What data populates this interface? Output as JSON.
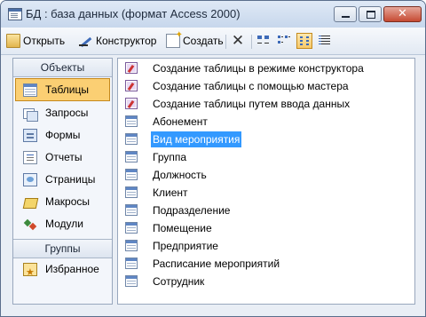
{
  "window": {
    "title": "БД : база данных (формат Access 2000)",
    "close_glyph": "✕"
  },
  "toolbar": {
    "open_label": "Открыть",
    "design_label": "Конструктор",
    "new_label": "Создать",
    "delete_glyph": "✕",
    "active_view": "list"
  },
  "objects_panel": {
    "objects_header": "Объекты",
    "items": [
      {
        "label": "Таблицы",
        "icon": "table-icon",
        "selected": true
      },
      {
        "label": "Запросы",
        "icon": "query-icon"
      },
      {
        "label": "Формы",
        "icon": "form-icon"
      },
      {
        "label": "Отчеты",
        "icon": "report-icon"
      },
      {
        "label": "Страницы",
        "icon": "page-icon"
      },
      {
        "label": "Макросы",
        "icon": "macro-icon"
      },
      {
        "label": "Модули",
        "icon": "module-icon"
      }
    ],
    "groups_header": "Группы",
    "groups": [
      {
        "label": "Избранное",
        "icon": "favorites-icon"
      }
    ]
  },
  "list": {
    "items": [
      {
        "label": "Создание таблицы в режиме конструктора",
        "icon": "create-shortcut-icon"
      },
      {
        "label": "Создание таблицы с помощью мастера",
        "icon": "create-shortcut-icon"
      },
      {
        "label": "Создание таблицы путем ввода данных",
        "icon": "create-shortcut-icon"
      },
      {
        "label": "Абонемент",
        "icon": "table-icon"
      },
      {
        "label": "Вид мероприятия",
        "icon": "table-icon",
        "selected": true
      },
      {
        "label": "Группа",
        "icon": "table-icon"
      },
      {
        "label": "Должность",
        "icon": "table-icon"
      },
      {
        "label": "Клиент",
        "icon": "table-icon"
      },
      {
        "label": "Подразделение",
        "icon": "table-icon"
      },
      {
        "label": "Помещение",
        "icon": "table-icon"
      },
      {
        "label": "Предприятие",
        "icon": "table-icon"
      },
      {
        "label": "Расписание мероприятий",
        "icon": "table-icon"
      },
      {
        "label": "Сотрудник",
        "icon": "table-icon"
      }
    ]
  }
}
